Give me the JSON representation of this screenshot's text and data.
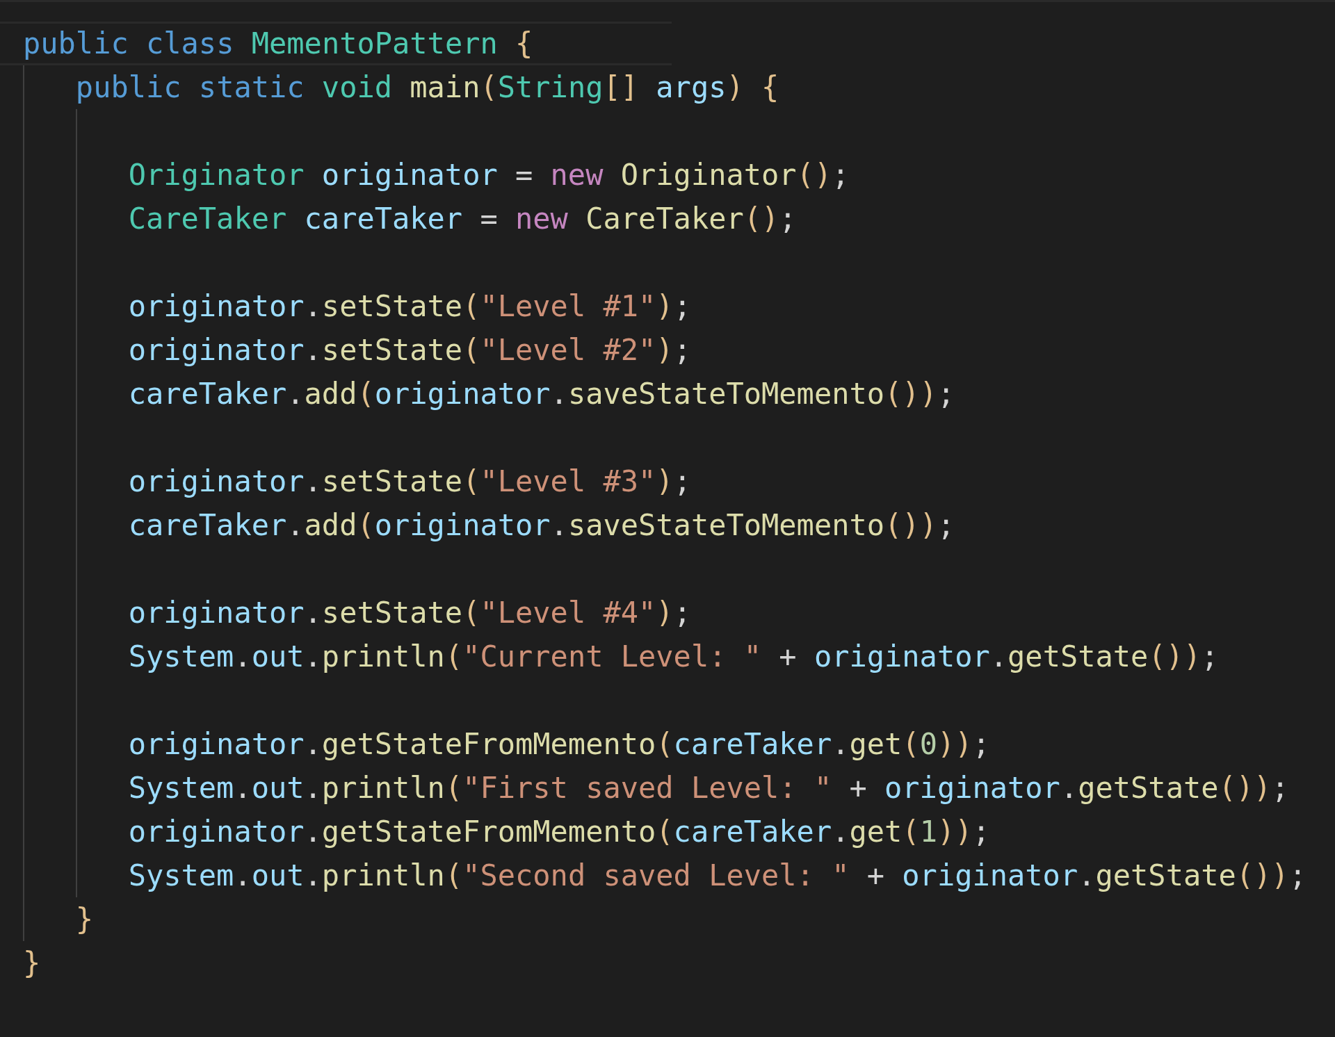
{
  "editor": {
    "lines": [
      {
        "kind": "code",
        "current": true,
        "tokens": [
          {
            "text": "public class ",
            "kind": "keyword"
          },
          {
            "text": "MementoPattern ",
            "kind": "type"
          },
          {
            "text": "{",
            "kind": "bracket"
          }
        ],
        "children": [
          {
            "kind": "code",
            "current": false,
            "tokens": [
              {
                "text": "public static ",
                "kind": "keyword"
              },
              {
                "text": "void ",
                "kind": "type"
              },
              {
                "text": "main",
                "kind": "function"
              },
              {
                "text": "(",
                "kind": "bracket"
              },
              {
                "text": "String",
                "kind": "type"
              },
              {
                "text": "[] ",
                "kind": "bracket"
              },
              {
                "text": "args",
                "kind": "variable"
              },
              {
                "text": ") ",
                "kind": "bracket"
              },
              {
                "text": "{",
                "kind": "bracket"
              }
            ],
            "children": [
              {
                "kind": "blank"
              },
              {
                "kind": "code",
                "current": false,
                "tokens": [
                  {
                    "text": "Originator ",
                    "kind": "type"
                  },
                  {
                    "text": "originator ",
                    "kind": "variable"
                  },
                  {
                    "text": "= ",
                    "kind": "plain"
                  },
                  {
                    "text": "new ",
                    "kind": "control"
                  },
                  {
                    "text": "Originator",
                    "kind": "function"
                  },
                  {
                    "text": "()",
                    "kind": "bracket"
                  },
                  {
                    "text": ";",
                    "kind": "plain"
                  }
                ]
              },
              {
                "kind": "code",
                "current": false,
                "tokens": [
                  {
                    "text": "CareTaker ",
                    "kind": "type"
                  },
                  {
                    "text": "careTaker ",
                    "kind": "variable"
                  },
                  {
                    "text": "= ",
                    "kind": "plain"
                  },
                  {
                    "text": "new ",
                    "kind": "control"
                  },
                  {
                    "text": "CareTaker",
                    "kind": "function"
                  },
                  {
                    "text": "()",
                    "kind": "bracket"
                  },
                  {
                    "text": ";",
                    "kind": "plain"
                  }
                ]
              },
              {
                "kind": "blank"
              },
              {
                "kind": "code",
                "current": false,
                "tokens": [
                  {
                    "text": "originator",
                    "kind": "variable"
                  },
                  {
                    "text": ".",
                    "kind": "plain"
                  },
                  {
                    "text": "setState",
                    "kind": "function"
                  },
                  {
                    "text": "(",
                    "kind": "bracket"
                  },
                  {
                    "text": "\"Level #1\"",
                    "kind": "string"
                  },
                  {
                    "text": ")",
                    "kind": "bracket"
                  },
                  {
                    "text": ";",
                    "kind": "plain"
                  }
                ]
              },
              {
                "kind": "code",
                "current": false,
                "tokens": [
                  {
                    "text": "originator",
                    "kind": "variable"
                  },
                  {
                    "text": ".",
                    "kind": "plain"
                  },
                  {
                    "text": "setState",
                    "kind": "function"
                  },
                  {
                    "text": "(",
                    "kind": "bracket"
                  },
                  {
                    "text": "\"Level #2\"",
                    "kind": "string"
                  },
                  {
                    "text": ")",
                    "kind": "bracket"
                  },
                  {
                    "text": ";",
                    "kind": "plain"
                  }
                ]
              },
              {
                "kind": "code",
                "current": false,
                "tokens": [
                  {
                    "text": "careTaker",
                    "kind": "variable"
                  },
                  {
                    "text": ".",
                    "kind": "plain"
                  },
                  {
                    "text": "add",
                    "kind": "function"
                  },
                  {
                    "text": "(",
                    "kind": "bracket"
                  },
                  {
                    "text": "originator",
                    "kind": "variable"
                  },
                  {
                    "text": ".",
                    "kind": "plain"
                  },
                  {
                    "text": "saveStateToMemento",
                    "kind": "function"
                  },
                  {
                    "text": "())",
                    "kind": "bracket"
                  },
                  {
                    "text": ";",
                    "kind": "plain"
                  }
                ]
              },
              {
                "kind": "blank"
              },
              {
                "kind": "code",
                "current": false,
                "tokens": [
                  {
                    "text": "originator",
                    "kind": "variable"
                  },
                  {
                    "text": ".",
                    "kind": "plain"
                  },
                  {
                    "text": "setState",
                    "kind": "function"
                  },
                  {
                    "text": "(",
                    "kind": "bracket"
                  },
                  {
                    "text": "\"Level #3\"",
                    "kind": "string"
                  },
                  {
                    "text": ")",
                    "kind": "bracket"
                  },
                  {
                    "text": ";",
                    "kind": "plain"
                  }
                ]
              },
              {
                "kind": "code",
                "current": false,
                "tokens": [
                  {
                    "text": "careTaker",
                    "kind": "variable"
                  },
                  {
                    "text": ".",
                    "kind": "plain"
                  },
                  {
                    "text": "add",
                    "kind": "function"
                  },
                  {
                    "text": "(",
                    "kind": "bracket"
                  },
                  {
                    "text": "originator",
                    "kind": "variable"
                  },
                  {
                    "text": ".",
                    "kind": "plain"
                  },
                  {
                    "text": "saveStateToMemento",
                    "kind": "function"
                  },
                  {
                    "text": "())",
                    "kind": "bracket"
                  },
                  {
                    "text": ";",
                    "kind": "plain"
                  }
                ]
              },
              {
                "kind": "blank"
              },
              {
                "kind": "code",
                "current": false,
                "tokens": [
                  {
                    "text": "originator",
                    "kind": "variable"
                  },
                  {
                    "text": ".",
                    "kind": "plain"
                  },
                  {
                    "text": "setState",
                    "kind": "function"
                  },
                  {
                    "text": "(",
                    "kind": "bracket"
                  },
                  {
                    "text": "\"Level #4\"",
                    "kind": "string"
                  },
                  {
                    "text": ")",
                    "kind": "bracket"
                  },
                  {
                    "text": ";",
                    "kind": "plain"
                  }
                ]
              },
              {
                "kind": "code",
                "current": false,
                "tokens": [
                  {
                    "text": "System",
                    "kind": "variable"
                  },
                  {
                    "text": ".",
                    "kind": "plain"
                  },
                  {
                    "text": "out",
                    "kind": "variable"
                  },
                  {
                    "text": ".",
                    "kind": "plain"
                  },
                  {
                    "text": "println",
                    "kind": "function"
                  },
                  {
                    "text": "(",
                    "kind": "bracket"
                  },
                  {
                    "text": "\"Current Level: \"",
                    "kind": "string"
                  },
                  {
                    "text": " + ",
                    "kind": "plain"
                  },
                  {
                    "text": "originator",
                    "kind": "variable"
                  },
                  {
                    "text": ".",
                    "kind": "plain"
                  },
                  {
                    "text": "getState",
                    "kind": "function"
                  },
                  {
                    "text": "())",
                    "kind": "bracket"
                  },
                  {
                    "text": ";",
                    "kind": "plain"
                  }
                ]
              },
              {
                "kind": "blank"
              },
              {
                "kind": "code",
                "current": false,
                "tokens": [
                  {
                    "text": "originator",
                    "kind": "variable"
                  },
                  {
                    "text": ".",
                    "kind": "plain"
                  },
                  {
                    "text": "getStateFromMemento",
                    "kind": "function"
                  },
                  {
                    "text": "(",
                    "kind": "bracket"
                  },
                  {
                    "text": "careTaker",
                    "kind": "variable"
                  },
                  {
                    "text": ".",
                    "kind": "plain"
                  },
                  {
                    "text": "get",
                    "kind": "function"
                  },
                  {
                    "text": "(",
                    "kind": "bracket"
                  },
                  {
                    "text": "0",
                    "kind": "number"
                  },
                  {
                    "text": "))",
                    "kind": "bracket"
                  },
                  {
                    "text": ";",
                    "kind": "plain"
                  }
                ]
              },
              {
                "kind": "code",
                "current": false,
                "tokens": [
                  {
                    "text": "System",
                    "kind": "variable"
                  },
                  {
                    "text": ".",
                    "kind": "plain"
                  },
                  {
                    "text": "out",
                    "kind": "variable"
                  },
                  {
                    "text": ".",
                    "kind": "plain"
                  },
                  {
                    "text": "println",
                    "kind": "function"
                  },
                  {
                    "text": "(",
                    "kind": "bracket"
                  },
                  {
                    "text": "\"First saved Level: \"",
                    "kind": "string"
                  },
                  {
                    "text": " + ",
                    "kind": "plain"
                  },
                  {
                    "text": "originator",
                    "kind": "variable"
                  },
                  {
                    "text": ".",
                    "kind": "plain"
                  },
                  {
                    "text": "getState",
                    "kind": "function"
                  },
                  {
                    "text": "())",
                    "kind": "bracket"
                  },
                  {
                    "text": ";",
                    "kind": "plain"
                  }
                ]
              },
              {
                "kind": "code",
                "current": false,
                "tokens": [
                  {
                    "text": "originator",
                    "kind": "variable"
                  },
                  {
                    "text": ".",
                    "kind": "plain"
                  },
                  {
                    "text": "getStateFromMemento",
                    "kind": "function"
                  },
                  {
                    "text": "(",
                    "kind": "bracket"
                  },
                  {
                    "text": "careTaker",
                    "kind": "variable"
                  },
                  {
                    "text": ".",
                    "kind": "plain"
                  },
                  {
                    "text": "get",
                    "kind": "function"
                  },
                  {
                    "text": "(",
                    "kind": "bracket"
                  },
                  {
                    "text": "1",
                    "kind": "number"
                  },
                  {
                    "text": "))",
                    "kind": "bracket"
                  },
                  {
                    "text": ";",
                    "kind": "plain"
                  }
                ]
              },
              {
                "kind": "code",
                "current": false,
                "tokens": [
                  {
                    "text": "System",
                    "kind": "variable"
                  },
                  {
                    "text": ".",
                    "kind": "plain"
                  },
                  {
                    "text": "out",
                    "kind": "variable"
                  },
                  {
                    "text": ".",
                    "kind": "plain"
                  },
                  {
                    "text": "println",
                    "kind": "function"
                  },
                  {
                    "text": "(",
                    "kind": "bracket"
                  },
                  {
                    "text": "\"Second saved Level: \"",
                    "kind": "string"
                  },
                  {
                    "text": " + ",
                    "kind": "plain"
                  },
                  {
                    "text": "originator",
                    "kind": "variable"
                  },
                  {
                    "text": ".",
                    "kind": "plain"
                  },
                  {
                    "text": "getState",
                    "kind": "function"
                  },
                  {
                    "text": "())",
                    "kind": "bracket"
                  },
                  {
                    "text": ";",
                    "kind": "plain"
                  }
                ]
              }
            ]
          },
          {
            "kind": "code",
            "current": false,
            "tokens": [
              {
                "text": "}",
                "kind": "bracket"
              }
            ]
          }
        ]
      },
      {
        "kind": "code",
        "current": false,
        "tokens": [
          {
            "text": "}",
            "kind": "bracket"
          }
        ]
      }
    ]
  }
}
